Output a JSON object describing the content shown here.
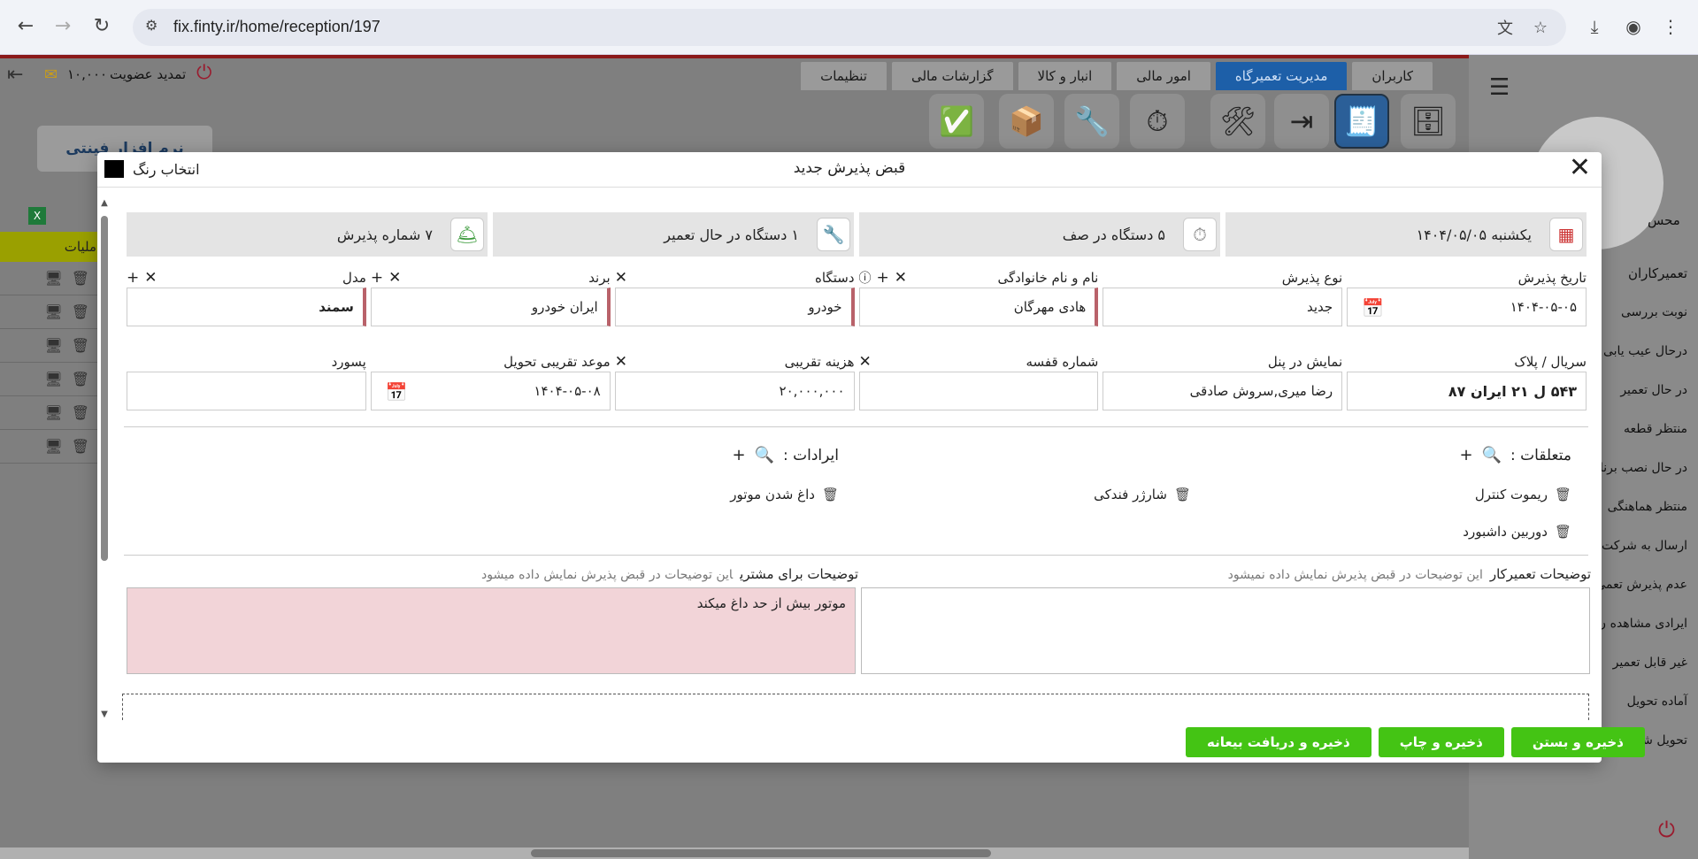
{
  "browser": {
    "url": "fix.finty.ir/home/reception/197"
  },
  "app": {
    "membership_label": "تمدید عضویت",
    "credit": "۱۰,۰۰۰",
    "logo_text": "نرم افزار فینتی",
    "tabs": [
      "کاربران",
      "مدیریت تعمیرگاه",
      "امور مالی",
      "انبار و کالا",
      "گزارشات مالی",
      "تنظیمات"
    ],
    "active_tab_index": 1,
    "left_header": "ملیات",
    "profile_label": "محس",
    "side_menu": [
      "تعمیرکاران",
      "نوبت بررسی",
      "درحال عیب یابی",
      "در حال تعمیر",
      "منتظر قطعه",
      "در حال نصب برنا",
      "منتظر هماهنگی",
      "ارسال به شرکت گا",
      "عدم پذیرش تعمی",
      "ایرادی مشاهده ن",
      "غیر قابل تعمیر",
      "آماده تحویل",
      "تحویل شده"
    ]
  },
  "modal": {
    "title": "قبض پذیرش جدید",
    "color_picker_label": "انتخاب رنگ",
    "color_value": "#000000",
    "stats": [
      {
        "icon": "calendar-icon",
        "text": "یکشنبه  ۱۴۰۴/۰۵/۰۵"
      },
      {
        "icon": "stopwatch-icon",
        "text": "۵  دستگاه در صف"
      },
      {
        "icon": "wrench-circle-icon",
        "text": "۱  دستگاه در حال تعمیر"
      },
      {
        "icon": "bell-icon",
        "text": "۷ شماره پذیرش"
      }
    ],
    "fields_row1": [
      {
        "label": "تاریخ پذیرش",
        "value": "۱۴۰۴-۰۵-۰۵"
      },
      {
        "label": "نوع پذیرش",
        "value": "جدید"
      },
      {
        "label": "نام و نام خانوادگی",
        "value": "هادی مهرگان"
      },
      {
        "label": "دستگاه",
        "value": "خودرو"
      },
      {
        "label": "برند",
        "value": "ایران خودرو"
      },
      {
        "label": "مدل",
        "value": "سمند"
      }
    ],
    "fields_row2": [
      {
        "label": "سریال / پلاک",
        "value": "۵۴۳ ل ۲۱ ایران ۸۷"
      },
      {
        "label": "نمایش در پنل",
        "value": "رضا میری,سروش صادقی"
      },
      {
        "label": "شماره قفسه",
        "value": ""
      },
      {
        "label": "هزینه تقریبی",
        "value": "۲۰,۰۰۰,۰۰۰"
      },
      {
        "label": "موعد تقریبی تحویل",
        "value": "۱۴۰۴-۰۵-۰۸"
      },
      {
        "label": "پسورد",
        "value": ""
      }
    ],
    "accessories": {
      "title": "متعلقات :",
      "items": [
        "ریموت کنترل",
        "شارژر فندکی",
        "دوربین داشبورد"
      ]
    },
    "issues": {
      "title": "ایرادات :",
      "items": [
        "داغ شدن موتور"
      ]
    },
    "tech_notes": {
      "label": "توضیحات تعمیرکار",
      "hint": "این توضیحات در قبض پذیرش نمایش داده نمیشود",
      "value": ""
    },
    "customer_notes": {
      "label": "توضیحات برای مشتری",
      "hint": "این توضیحات در قبض پذیرش نمایش داده میشود",
      "value": "موتور بیش از حد داغ میکند"
    },
    "buttons": [
      "ذخیره و بستن",
      "ذخیره و چاپ",
      "ذخیره و دریافت بیعانه"
    ],
    "button_color": "#44c414"
  }
}
